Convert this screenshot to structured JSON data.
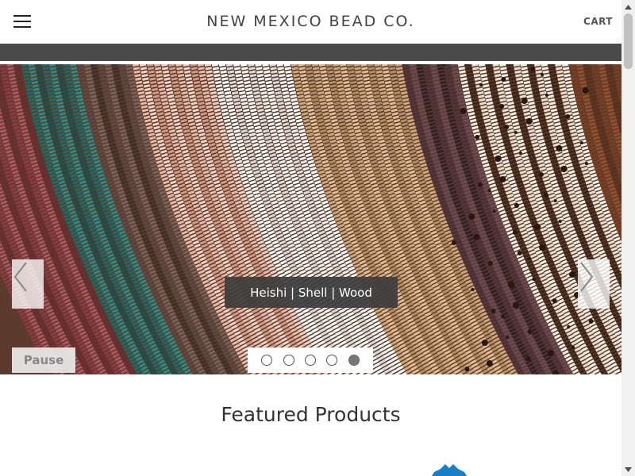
{
  "header": {
    "brand": "NEW MEXICO BEAD CO.",
    "cart_label": "CART",
    "menu_icon": "hamburger-icon"
  },
  "hero": {
    "caption": "Heishi | Shell | Wood",
    "pause_label": "Pause",
    "prev_icon": "chevron-left-icon",
    "next_icon": "chevron-right-icon",
    "slide_count": 5,
    "active_slide": 5
  },
  "main": {
    "featured_heading": "Featured Products"
  },
  "colors": {
    "navbar": "#4a4a4a",
    "caption_bg": "#3c3c3c",
    "peek_icon": "#1a7fc4"
  }
}
